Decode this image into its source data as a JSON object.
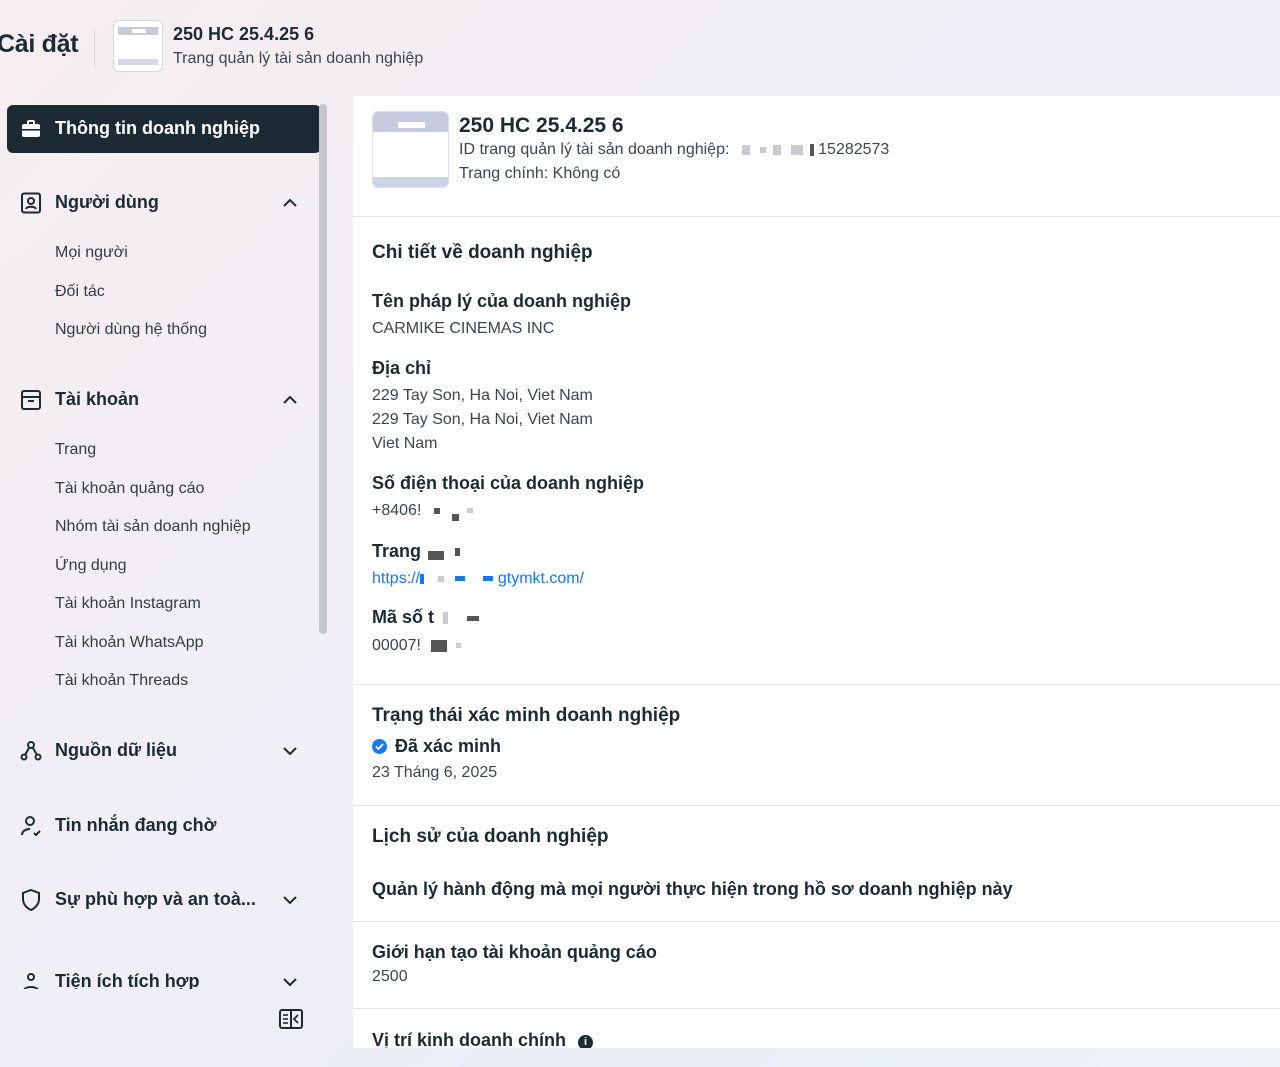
{
  "header": {
    "title": "Cài đặt",
    "business_name": "250 HC 25.4.25 6",
    "subtitle": "Trang quản lý tài sản doanh nghiệp"
  },
  "sidebar": {
    "active_item": {
      "label": "Thông tin doanh nghiệp",
      "icon": "briefcase-icon"
    },
    "sections": [
      {
        "label": "Người dùng",
        "icon": "id-badge-icon",
        "expanded": true,
        "items": [
          "Mọi người",
          "Đối tác",
          "Người dùng hệ thống"
        ]
      },
      {
        "label": "Tài khoản",
        "icon": "archive-icon",
        "expanded": true,
        "items": [
          "Trang",
          "Tài khoản quảng cáo",
          "Nhóm tài sản doanh nghiệp",
          "Ứng dụng",
          "Tài khoản Instagram",
          "Tài khoản WhatsApp",
          "Tài khoản Threads"
        ]
      },
      {
        "label": "Nguồn dữ liệu",
        "icon": "data-sources-icon",
        "expanded": false
      },
      {
        "label": "Tin nhắn đang chờ",
        "icon": "person-icon",
        "expanded": false
      },
      {
        "label": "Sự phù hợp và an toà...",
        "icon": "shield-icon",
        "expanded": false
      },
      {
        "label": "Tiện ích tích hợp",
        "icon": "integrations-icon",
        "expanded": false
      }
    ]
  },
  "main": {
    "summary": {
      "name": "250 HC 25.4.25 6",
      "id_label": "ID trang quản lý tài sản doanh nghiệp:",
      "id_value": "15282573",
      "primary_page": "Trang chính: Không có"
    },
    "details": {
      "title": "Chi tiết về doanh nghiệp",
      "legal_name_label": "Tên pháp lý của doanh nghiệp",
      "legal_name": "CARMIKE CINEMAS INC",
      "address_label": "Địa chỉ",
      "address_line1": "229 Tay Son, Ha Noi, Viet Nam",
      "address_line2": "229 Tay Son, Ha Noi, Viet Nam",
      "address_line3": "Viet Nam",
      "phone_label": "Số điện thoại của doanh nghiệp",
      "phone_value": "+8406!",
      "website_label": "Trang",
      "website_prefix": "https://",
      "website_suffix": "gtymkt.com/",
      "tax_label": "Mã số t",
      "tax_value": "00007!"
    },
    "verification": {
      "title": "Trạng thái xác minh doanh nghiệp",
      "status": "Đã xác minh",
      "date": "23 Tháng 6, 2025"
    },
    "history": {
      "title": "Lịch sử của doanh nghiệp",
      "link": "Quản lý hành động mà mọi người thực hiện trong hồ sơ doanh nghiệp này"
    },
    "ad_limit": {
      "title": "Giới hạn tạo tài khoản quảng cáo",
      "value": "2500"
    },
    "location": {
      "title": "Vị trí kinh doanh chính"
    }
  }
}
